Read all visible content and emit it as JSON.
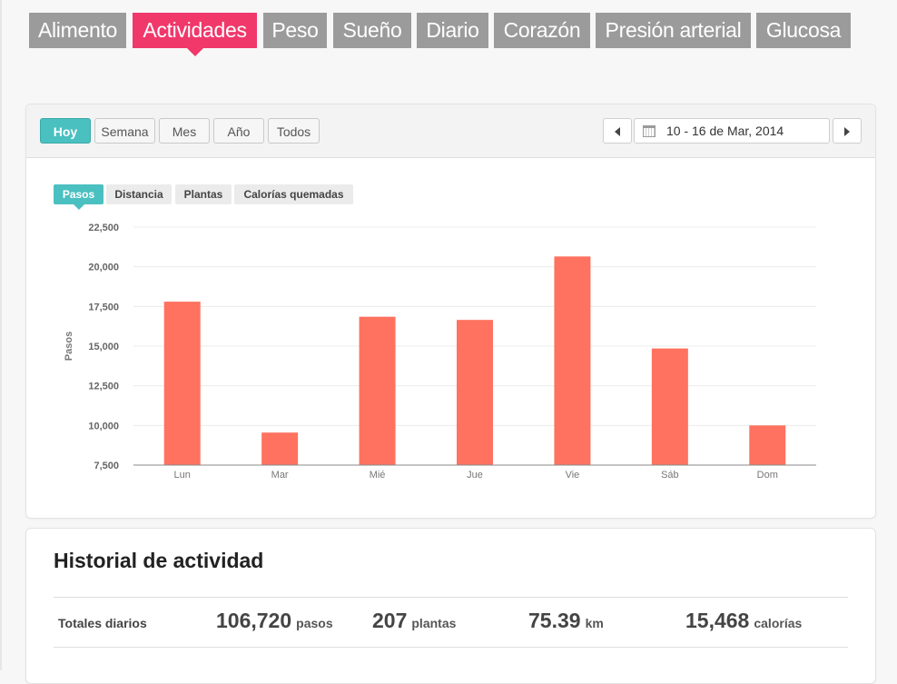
{
  "tabs": [
    "Alimento",
    "Actividades",
    "Peso",
    "Sueño",
    "Diario",
    "Corazón",
    "Presión arterial",
    "Glucosa"
  ],
  "active_tab": "Actividades",
  "range_buttons": [
    "Hoy",
    "Semana",
    "Mes",
    "Año",
    "Todos"
  ],
  "active_range": "Hoy",
  "date_range": "10 - 16 de Mar, 2014",
  "metric_tabs": [
    "Pasos",
    "Distancia",
    "Plantas",
    "Calorías quemadas"
  ],
  "active_metric": "Pasos",
  "colors": {
    "accent": "#f0386b",
    "teal": "#4bc0c0",
    "bar": "#ff7260",
    "tab": "#9b9b9b"
  },
  "chart_data": {
    "type": "bar",
    "categories": [
      "Lun",
      "Mar",
      "Mié",
      "Jue",
      "Vie",
      "Sáb",
      "Dom"
    ],
    "values": [
      17800,
      9550,
      16850,
      16650,
      20650,
      14850,
      10000
    ],
    "ylabel": "Pasos",
    "ylim": [
      7500,
      22500
    ],
    "yticks": [
      7500,
      10000,
      12500,
      15000,
      17500,
      20000,
      22500
    ],
    "ytick_labels": [
      "7,500",
      "10,000",
      "12,500",
      "15,000",
      "17,500",
      "20,000",
      "22,500"
    ],
    "grid": true,
    "legend": "none"
  },
  "history": {
    "title": "Historial de actividad",
    "totals_label": "Totales diarios",
    "stats": [
      {
        "value": "106,720",
        "unit": "pasos"
      },
      {
        "value": "207",
        "unit": "plantas"
      },
      {
        "value": "75.39",
        "unit": "km"
      },
      {
        "value": "15,468",
        "unit": "calorías"
      }
    ]
  }
}
